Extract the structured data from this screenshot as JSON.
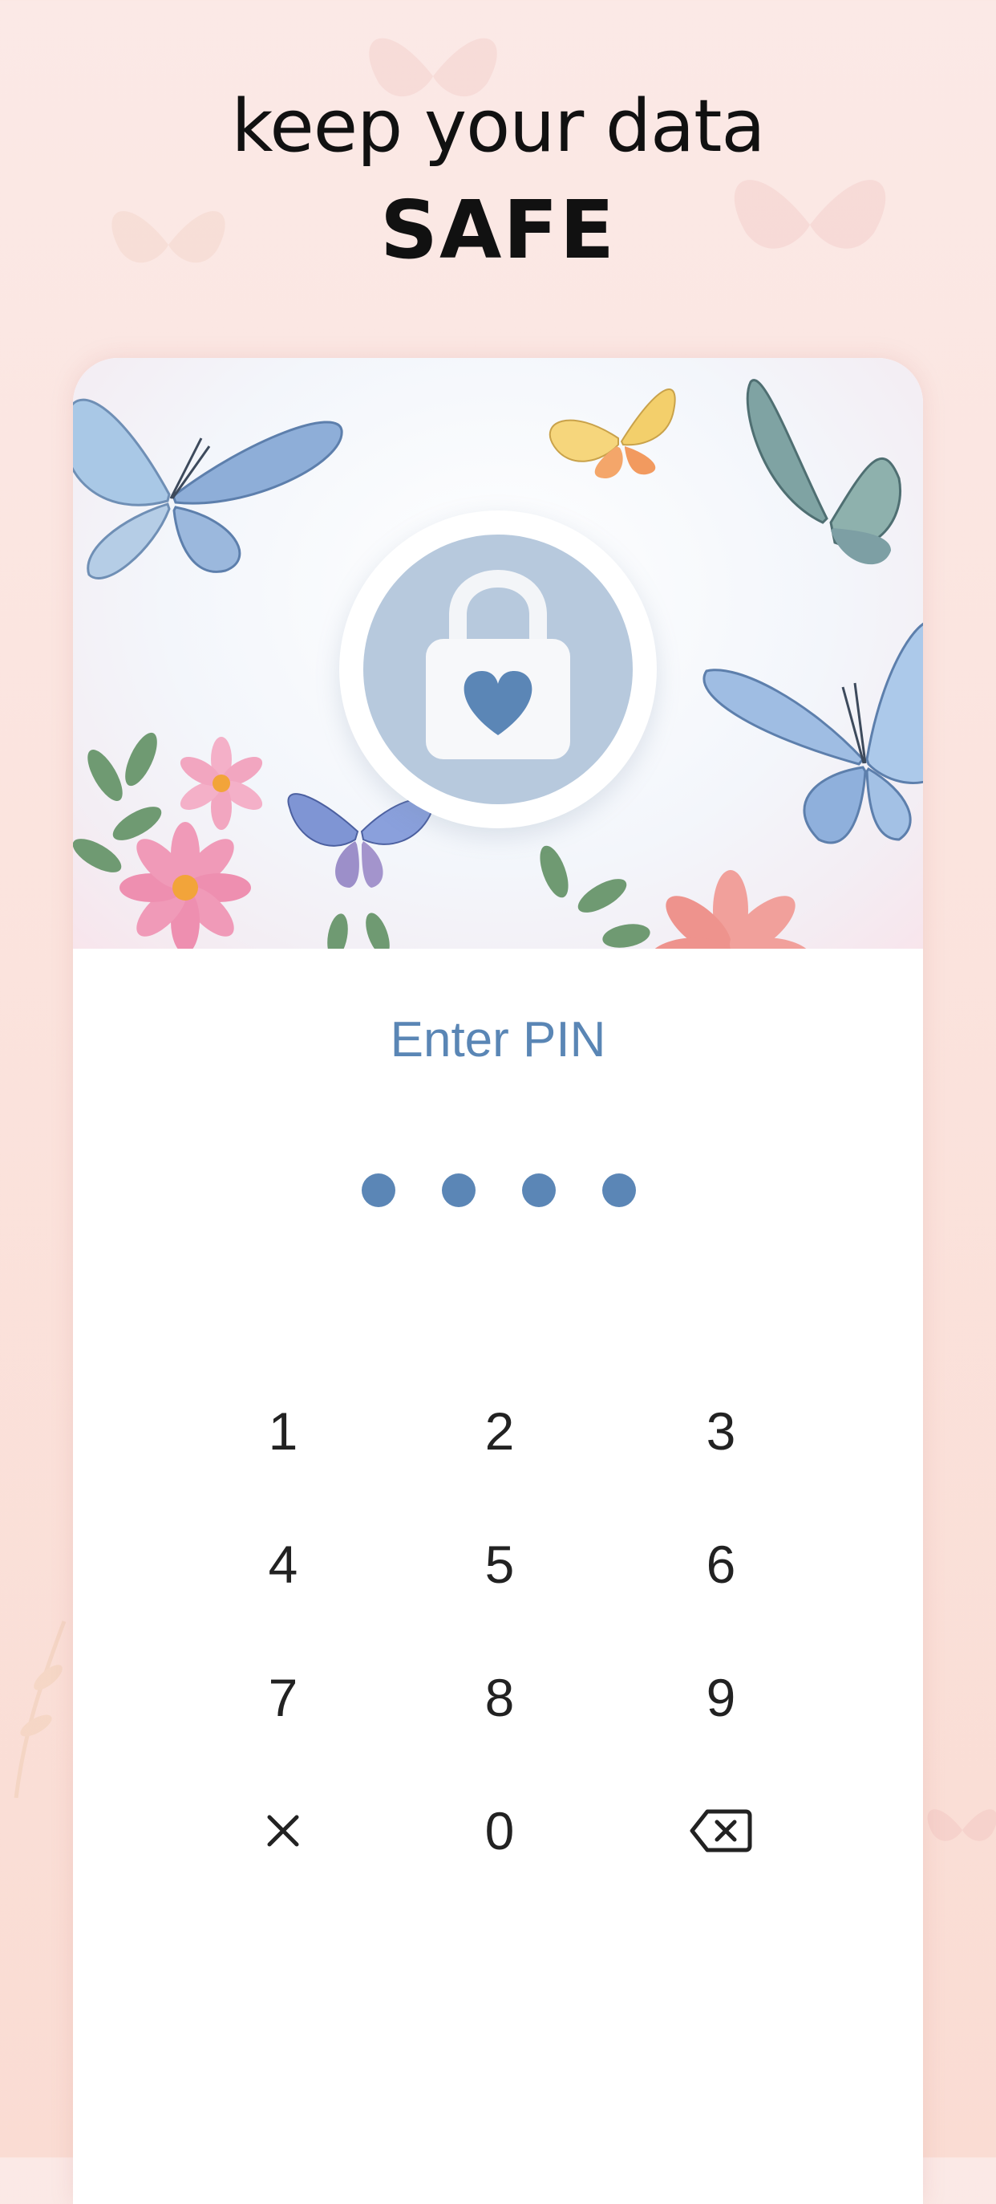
{
  "headline": {
    "line1": "keep your data",
    "line2": "SAFE"
  },
  "lock": {
    "icon": "lock-heart-icon",
    "accent": "#5b86b6"
  },
  "pin": {
    "title": "Enter PIN",
    "entered_digits": 4
  },
  "keypad": {
    "keys": [
      "1",
      "2",
      "3",
      "4",
      "5",
      "6",
      "7",
      "8",
      "9",
      "×",
      "0",
      "⌫"
    ],
    "clear_icon": "close-icon",
    "backspace_icon": "backspace-icon"
  },
  "colors": {
    "background": "#fbe4de",
    "accent": "#5b86b6",
    "lock_circle": "#b7c9dd"
  }
}
